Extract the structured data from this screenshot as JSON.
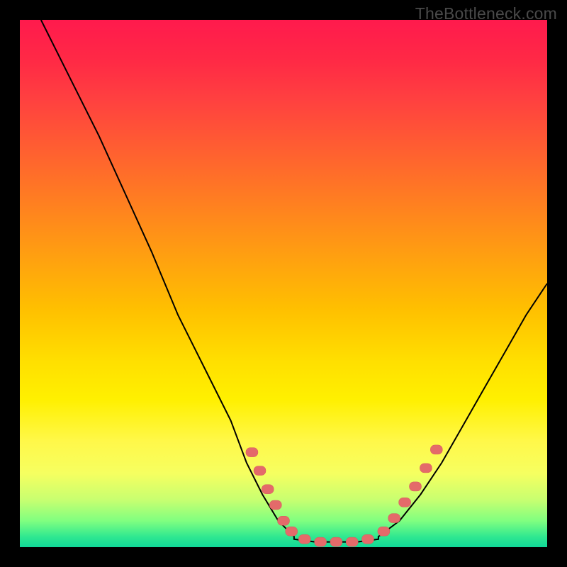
{
  "watermark": "TheBottleneck.com",
  "chart_data": {
    "type": "line",
    "title": "",
    "xlabel": "",
    "ylabel": "",
    "xlim": [
      0,
      100
    ],
    "ylim": [
      0,
      100
    ],
    "series": [
      {
        "name": "curve-left",
        "x": [
          4,
          10,
          15,
          20,
          25,
          30,
          35,
          40,
          43,
          46,
          49,
          52
        ],
        "y": [
          100,
          88,
          78,
          67,
          56,
          44,
          34,
          24,
          16,
          10,
          5,
          2
        ]
      },
      {
        "name": "curve-flat",
        "x": [
          52,
          56,
          60,
          64,
          68
        ],
        "y": [
          1.5,
          1,
          1,
          1,
          1.5
        ]
      },
      {
        "name": "curve-right",
        "x": [
          68,
          72,
          76,
          80,
          84,
          88,
          92,
          96,
          100
        ],
        "y": [
          2,
          5,
          10,
          16,
          23,
          30,
          37,
          44,
          50
        ]
      }
    ],
    "markers": [
      {
        "name": "marker-left-group",
        "points": [
          {
            "x": 44,
            "y": 18
          },
          {
            "x": 45.5,
            "y": 14.5
          },
          {
            "x": 47,
            "y": 11
          },
          {
            "x": 48.5,
            "y": 8
          },
          {
            "x": 50,
            "y": 5
          },
          {
            "x": 51.5,
            "y": 3
          }
        ]
      },
      {
        "name": "marker-flat-group",
        "points": [
          {
            "x": 54,
            "y": 1.5
          },
          {
            "x": 57,
            "y": 1
          },
          {
            "x": 60,
            "y": 1
          },
          {
            "x": 63,
            "y": 1
          },
          {
            "x": 66,
            "y": 1.5
          }
        ]
      },
      {
        "name": "marker-right-group",
        "points": [
          {
            "x": 69,
            "y": 3
          },
          {
            "x": 71,
            "y": 5.5
          },
          {
            "x": 73,
            "y": 8.5
          },
          {
            "x": 75,
            "y": 11.5
          },
          {
            "x": 77,
            "y": 15
          },
          {
            "x": 79,
            "y": 18.5
          }
        ]
      }
    ],
    "colors": {
      "curve": "#000000",
      "marker_fill": "#e46a6a",
      "marker_stroke": "#d65a5a"
    }
  }
}
